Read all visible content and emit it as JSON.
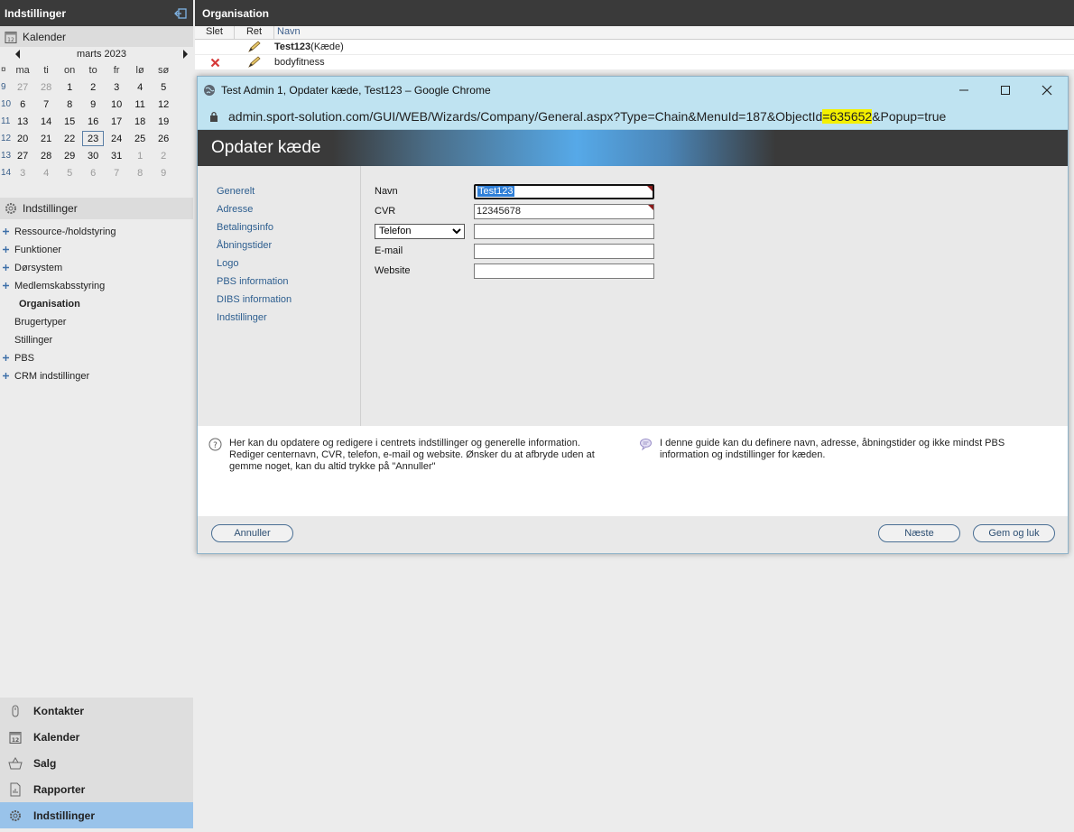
{
  "sidebar": {
    "title": "Indstillinger",
    "calendar_section": "Kalender",
    "calendar": {
      "month": "marts 2023",
      "weekday_labels": [
        "on",
        "to",
        "ti",
        "fr",
        "lø",
        "sø",
        "ma"
      ],
      "dow": [
        "ma",
        "ti",
        "on",
        "to",
        "fr",
        "lø",
        "sø"
      ],
      "weeks": [
        {
          "wk": "9",
          "days": [
            "27",
            "28",
            "1",
            "2",
            "3",
            "4",
            "5"
          ]
        },
        {
          "wk": "10",
          "days": [
            "6",
            "7",
            "8",
            "9",
            "10",
            "11",
            "12"
          ]
        },
        {
          "wk": "11",
          "days": [
            "13",
            "14",
            "15",
            "16",
            "17",
            "18",
            "19"
          ]
        },
        {
          "wk": "12",
          "days": [
            "20",
            "21",
            "22",
            "23",
            "24",
            "25",
            "26"
          ]
        },
        {
          "wk": "13",
          "days": [
            "27",
            "28",
            "29",
            "30",
            "31",
            "1",
            "2"
          ]
        },
        {
          "wk": "14",
          "days": [
            "3",
            "4",
            "5",
            "6",
            "7",
            "8",
            "9"
          ]
        }
      ],
      "selected_day": "23"
    },
    "settings_section": "Indstillinger",
    "tree": [
      "Ressource-/holdstyring",
      "Funktioner",
      "Dørsystem",
      "Medlemskabsstyring",
      "Organisation",
      "Brugertyper",
      "Stillinger",
      "PBS",
      "CRM indstillinger"
    ],
    "bottom_nav": [
      "Kontakter",
      "Kalender",
      "Salg",
      "Rapporter",
      "Indstillinger"
    ]
  },
  "main": {
    "title": "Organisation",
    "columns": [
      "Slet",
      "Ret",
      "Navn"
    ],
    "rows": [
      {
        "name": "Test123",
        "suffix": "(Kæde)"
      },
      {
        "name": "bodyfitness",
        "suffix": ""
      }
    ]
  },
  "popup": {
    "window_title": "Test Admin 1, Opdater kæde, Test123 – Google Chrome",
    "url_before": "admin.sport-solution.com/GUI/WEB/Wizards/Company/General.aspx?Type=Chain&MenuId=187&ObjectId",
    "url_highlight": "=635652",
    "url_after": "&Popup=true",
    "wizard_title": "Opdater kæde",
    "nav": [
      "Generelt",
      "Adresse",
      "Betalingsinfo",
      "Åbningstider",
      "Logo",
      "PBS information",
      "DIBS information",
      "Indstillinger"
    ],
    "form": {
      "navn_label": "Navn",
      "navn_value": "Test123",
      "cvr_label": "CVR",
      "cvr_value": "12345678",
      "phone_select": "Telefon",
      "phone_value": "",
      "email_label": "E-mail",
      "email_value": "",
      "website_label": "Website",
      "website_value": ""
    },
    "help_left": "Her kan du opdatere og redigere i centrets indstillinger og generelle information. Rediger centernavn, CVR, telefon, e-mail og website. Ønsker du at afbryde uden at gemme noget, kan du altid trykke på \"Annuller\"",
    "help_right": "I denne guide kan du definere navn, adresse, åbningstider og ikke mindst PBS information og indstillinger for kæden.",
    "buttons": {
      "cancel": "Annuller",
      "next": "Næste",
      "save": "Gem og luk"
    }
  },
  "colors": {
    "header_bg": "#3a3a3a",
    "active_nav": "#99c3ea",
    "chrome_bar": "#bfe3f1",
    "url_highlight": "#f4f000",
    "link": "#2d5e8f"
  }
}
